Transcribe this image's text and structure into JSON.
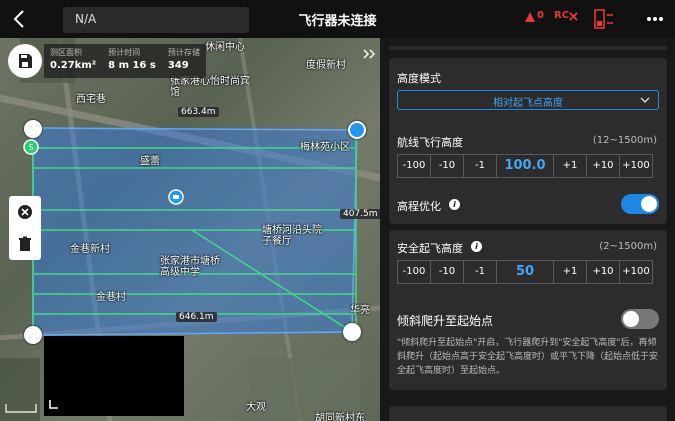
{
  "topbar": {
    "back_icon": "chevron-left-icon",
    "status_text": "N/A",
    "title": "飞行器未连接",
    "signal_value": "0",
    "rc_label": "RC",
    "more_icon": "more-dots-icon"
  },
  "map": {
    "stats": [
      {
        "label": "测区面积",
        "value": "0.27km²"
      },
      {
        "label": "预计时间",
        "value": "8 m 16 s"
      },
      {
        "label": "预计存储",
        "value": "349"
      }
    ],
    "distances": [
      "663.4m",
      "407.5m",
      "646.1m"
    ],
    "place_labels": [
      "休闲中心",
      "度假新村",
      "西宅巷",
      "张家港心怡时尚宾馆",
      "盛蕾",
      "梅林苑小区",
      "金巷新村",
      "张家港市塘桥高级中学",
      "金巷村",
      "塘桥河沿头院子餐厅",
      "华亮",
      "胡同新村东",
      "大观"
    ],
    "colors": {
      "area_fill": "#2f7ff0",
      "flight_line": "#3ddc84"
    }
  },
  "panel": {
    "height_mode": {
      "label": "高度模式",
      "selected": "相对起飞点高度"
    },
    "route_height": {
      "label": "航线飞行高度",
      "range": "(12~1500m)",
      "value": "100.0"
    },
    "terrain_follow": {
      "label": "高程优化",
      "enabled": true
    },
    "safe_takeoff": {
      "label": "安全起飞高度",
      "range": "(2~1500m)",
      "value": "50"
    },
    "oblique_climb": {
      "label": "倾斜爬升至起始点",
      "enabled": false
    },
    "steps_minus": [
      "-100",
      "-10",
      "-1"
    ],
    "steps_plus": [
      "+1",
      "+10",
      "+100"
    ],
    "description": "\"倾斜爬升至起始点\"开启，飞行器爬升到\"安全起飞高度\"后，再倾斜爬升（起始点高于安全起飞高度时）或平飞下降（起始点低于安全起飞高度时）至起始点。",
    "accent": "#1e88e5"
  }
}
